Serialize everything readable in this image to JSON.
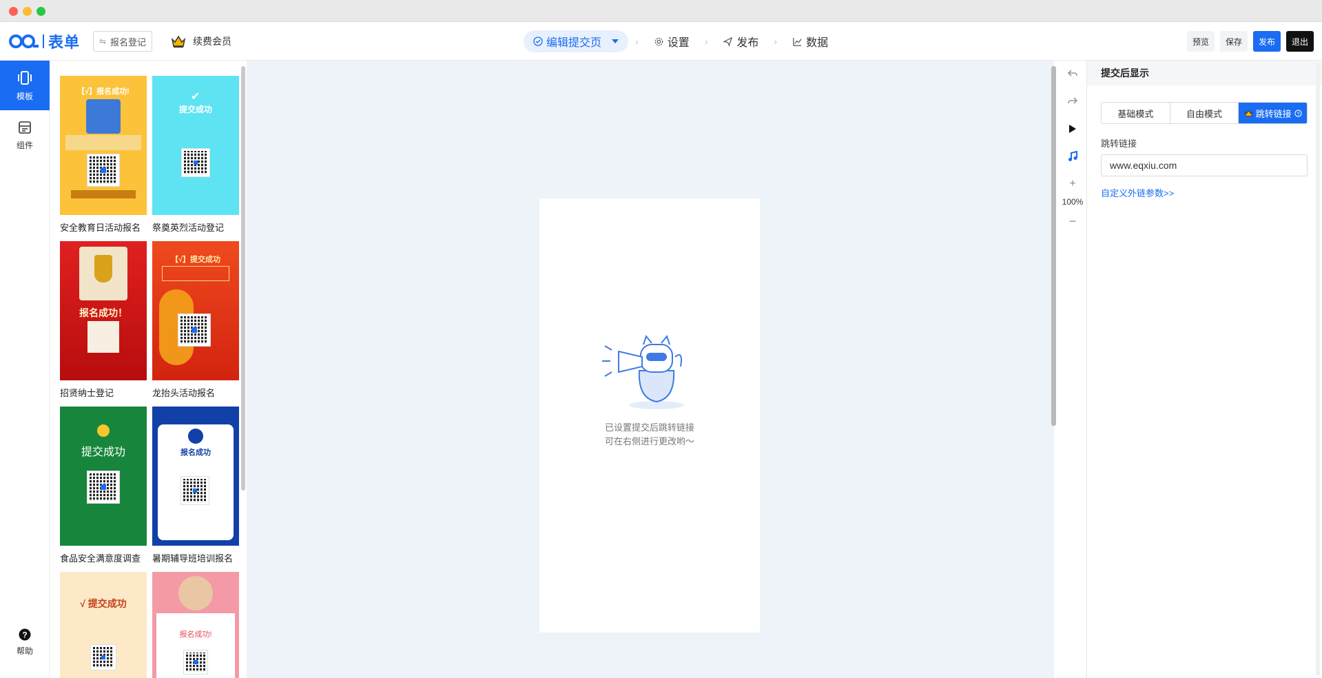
{
  "app": {
    "logo_text": "表单",
    "form_title": "报名登记",
    "vip_label": "续费会员"
  },
  "steps": [
    {
      "label": "编辑提交页",
      "icon": "check-circle-icon",
      "active": true
    },
    {
      "label": "设置",
      "icon": "gear-icon"
    },
    {
      "label": "发布",
      "icon": "send-icon"
    },
    {
      "label": "数据",
      "icon": "chart-icon"
    }
  ],
  "header_actions": {
    "preview": "预览",
    "save": "保存",
    "publish": "发布",
    "exit": "退出"
  },
  "leftnav": {
    "template": "模板",
    "component": "组件",
    "help": "帮助"
  },
  "templates": [
    {
      "name": "安全教育日活动报名",
      "title": "【√】报名成功!",
      "bg": "#fcc33a"
    },
    {
      "name": "祭奠英烈活动登记",
      "title": "提交成功",
      "bg": "#5ee3f3"
    },
    {
      "name": "招贤纳士登记",
      "title": "报名成功！",
      "bg": "#d81414"
    },
    {
      "name": "龙抬头活动报名",
      "title": "【√】提交成功",
      "bg": "#e8361a"
    },
    {
      "name": "食品安全满意度调查",
      "title": "提交成功",
      "bg": "#17863c"
    },
    {
      "name": "暑期辅导班培训报名",
      "title": "报名成功",
      "bg": "#1140a8"
    },
    {
      "name": "",
      "title": "√ 提交成功",
      "bg": "#fde9c8"
    },
    {
      "name": "",
      "title": "报名成功!",
      "bg": "#f39aa6"
    }
  ],
  "canvas": {
    "empty_line1": "已设置提交后跳转链接",
    "empty_line2": "可在右侧进行更改哟～"
  },
  "zoom": "100%",
  "settings": {
    "heading": "提交后显示",
    "modes": [
      "基础模式",
      "自由模式",
      "跳转链接"
    ],
    "active_mode": "跳转链接",
    "field_label": "跳转链接",
    "field_value": "www.eqxiu.com",
    "custom_params_link": "自定义外链参数>>"
  },
  "colors": {
    "accent": "#1a6cf2",
    "canvas_bg": "#eef2f9"
  }
}
